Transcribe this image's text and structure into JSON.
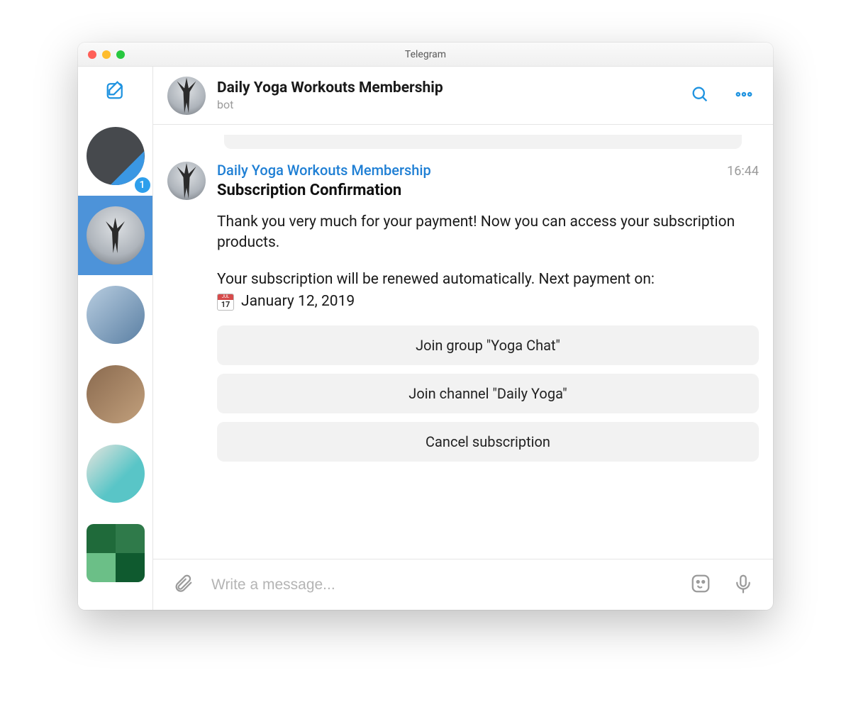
{
  "window": {
    "title": "Telegram"
  },
  "sidebar": {
    "items": [
      {
        "badge": "1"
      }
    ]
  },
  "header": {
    "name": "Daily Yoga Workouts Membership",
    "subtitle": "bot"
  },
  "message": {
    "sender": "Daily Yoga Workouts Membership",
    "time": "16:44",
    "title": "Subscription Confirmation",
    "paragraph1": "Thank you very much for your payment! Now you can access your subscription products.",
    "paragraph2": "Your subscription will be renewed automatically. Next payment on:",
    "date": "January 12, 2019",
    "calendar_day": "17",
    "buttons": {
      "b1": "Join group \"Yoga Chat\"",
      "b2": "Join channel \"Daily Yoga\"",
      "b3": "Cancel subscription"
    }
  },
  "composer": {
    "placeholder": "Write a message..."
  }
}
